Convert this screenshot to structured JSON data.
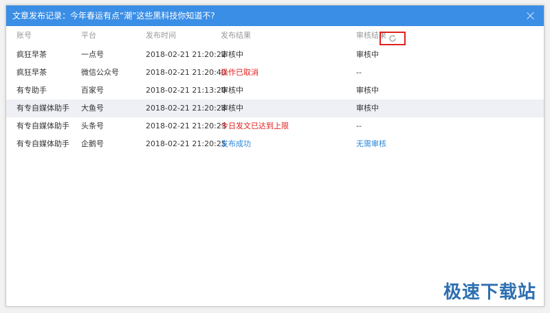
{
  "window": {
    "title": "文章发布记录：今年春运有点“潮”这些黑科技你知道不?"
  },
  "table": {
    "headers": [
      "账号",
      "平台",
      "发布时间",
      "发布结果",
      "审核结果"
    ],
    "rows": [
      {
        "account": "疯狂早茶",
        "platform": "一点号",
        "time": "2018-02-21 21:20:22",
        "result": "审核中",
        "review": "审核中"
      },
      {
        "account": "疯狂早茶",
        "platform": "微信公众号",
        "time": "2018-02-21 21:20:40",
        "result": "操作已取消",
        "review": "--"
      },
      {
        "account": "有专助手",
        "platform": "百家号",
        "time": "2018-02-21 21:13:20",
        "result": "审核中",
        "review": "审核中"
      },
      {
        "account": "有专自媒体助手",
        "platform": "大鱼号",
        "time": "2018-02-21 21:20:23",
        "result": "审核中",
        "review": "审核中"
      },
      {
        "account": "有专自媒体助手",
        "platform": "头条号",
        "time": "2018-02-21 21:20:23",
        "result": "今日发文已达到上限",
        "review": "--"
      },
      {
        "account": "有专自媒体助手",
        "platform": "企鹅号",
        "time": "2018-02-21 21:20:25",
        "result": "发布成功",
        "review": "无需审核"
      }
    ]
  },
  "icons": {
    "close": "close-icon",
    "refresh": "refresh-icon"
  },
  "watermark": "极速下载站",
  "colors": {
    "titlebar": "#3a8ee6",
    "error": "#e02020",
    "success": "#2b86d9",
    "highlight_row": "#eef0f5"
  }
}
